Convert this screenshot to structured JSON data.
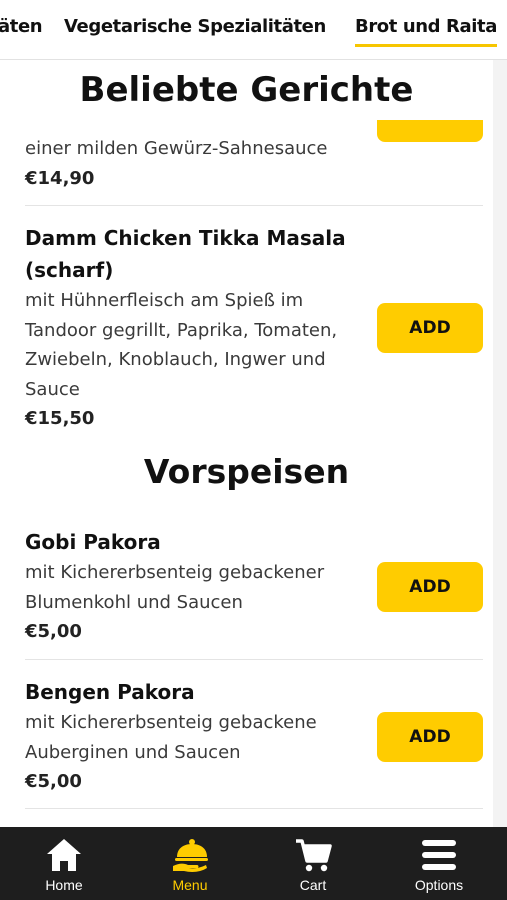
{
  "category_tabs": [
    {
      "label": "äten",
      "active": false
    },
    {
      "label": "Vegetarische Spezialitäten",
      "active": false
    },
    {
      "label": "Brot und Raita",
      "active": true
    }
  ],
  "sections": {
    "popular_title": "Beliebte Gerichte",
    "starters_title": "Vorspeisen"
  },
  "dishes": {
    "partial": {
      "description": "einer milden Gewürz-Sahnesauce",
      "price": "€14,90"
    },
    "tikka": {
      "name_line1": "Damm Chicken Tikka Masala",
      "name_line2": "(scharf)",
      "desc_lines": [
        "mit Hühnerfleisch am Spieß im",
        "Tandoor gegrillt, Paprika, Tomaten,",
        "Zwiebeln, Knoblauch, Ingwer und",
        "Sauce"
      ],
      "price": "€15,50",
      "add_label": "ADD"
    },
    "gobi": {
      "name": "Gobi Pakora",
      "desc_lines": [
        "mit Kichererbsenteig gebackener",
        "Blumenkohl und Saucen"
      ],
      "price": "€5,00",
      "add_label": "ADD"
    },
    "bengen": {
      "name": "Bengen Pakora",
      "desc_lines": [
        "mit Kichererbsenteig gebackene",
        "Auberginen und Saucen"
      ],
      "price": "€5,00",
      "add_label": "ADD"
    }
  },
  "bottom_nav": [
    {
      "label": "Home",
      "icon": "home-icon",
      "active": false
    },
    {
      "label": "Menu",
      "icon": "menu-cloche-icon",
      "active": true
    },
    {
      "label": "Cart",
      "icon": "cart-icon",
      "active": false
    },
    {
      "label": "Options",
      "icon": "hamburger-icon",
      "active": false
    }
  ],
  "colors": {
    "accent": "#ffcc00",
    "nav_background": "#1e1e1e"
  }
}
